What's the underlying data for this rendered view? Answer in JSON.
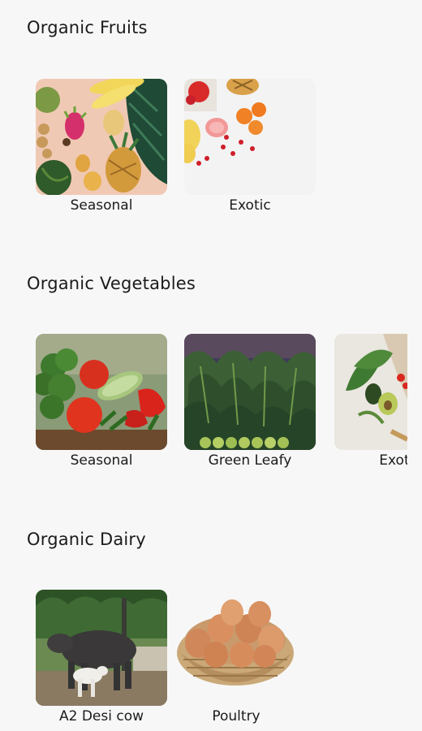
{
  "sections": [
    {
      "title": "Organic Fruits",
      "items": [
        {
          "label": "Seasonal",
          "image": "seasonal-fruits-image"
        },
        {
          "label": "Exotic",
          "image": "exotic-fruits-image"
        }
      ]
    },
    {
      "title": "Organic Vegetables",
      "items": [
        {
          "label": "Seasonal",
          "image": "seasonal-vegetables-image"
        },
        {
          "label": "Green Leafy",
          "image": "green-leafy-vegetables-image"
        },
        {
          "label": "Exotic",
          "image": "exotic-vegetables-image"
        }
      ]
    },
    {
      "title": "Organic Dairy",
      "items": [
        {
          "label": "A2 Desi cow",
          "image": "desi-cow-image"
        },
        {
          "label": "Poultry",
          "image": "eggs-basket-image"
        }
      ]
    }
  ],
  "colors": {
    "background": "#f7f7f7",
    "text": "#1b1b1b"
  }
}
